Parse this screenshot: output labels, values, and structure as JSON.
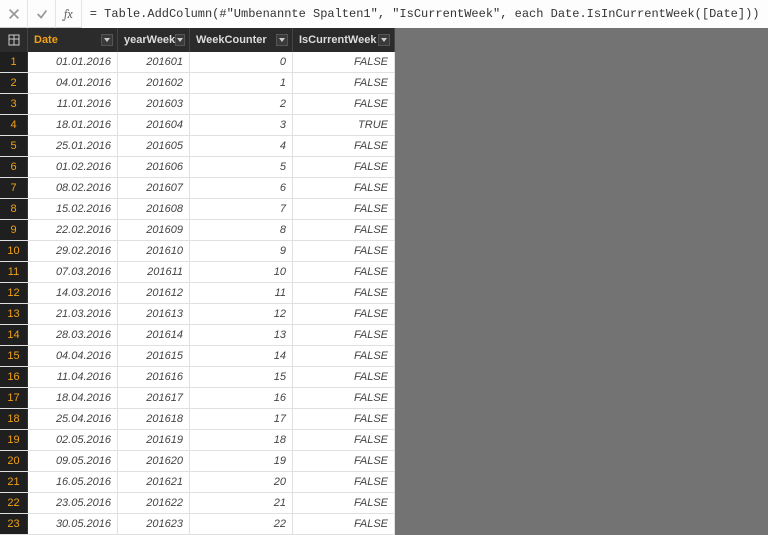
{
  "formula_bar": {
    "fx": "fx",
    "formula": "= Table.AddColumn(#\"Umbenannte Spalten1\", \"IsCurrentWeek\", each Date.IsInCurrentWeek([Date]))"
  },
  "columns": {
    "c0": "Date",
    "c1": "yearWeek",
    "c2": "WeekCounter",
    "c3": "IsCurrentWeek"
  },
  "rows": [
    {
      "n": "1",
      "date": "01.01.2016",
      "yw": "201601",
      "wc": "0",
      "cw": "FALSE"
    },
    {
      "n": "2",
      "date": "04.01.2016",
      "yw": "201602",
      "wc": "1",
      "cw": "FALSE"
    },
    {
      "n": "3",
      "date": "11.01.2016",
      "yw": "201603",
      "wc": "2",
      "cw": "FALSE"
    },
    {
      "n": "4",
      "date": "18.01.2016",
      "yw": "201604",
      "wc": "3",
      "cw": "TRUE"
    },
    {
      "n": "5",
      "date": "25.01.2016",
      "yw": "201605",
      "wc": "4",
      "cw": "FALSE"
    },
    {
      "n": "6",
      "date": "01.02.2016",
      "yw": "201606",
      "wc": "5",
      "cw": "FALSE"
    },
    {
      "n": "7",
      "date": "08.02.2016",
      "yw": "201607",
      "wc": "6",
      "cw": "FALSE"
    },
    {
      "n": "8",
      "date": "15.02.2016",
      "yw": "201608",
      "wc": "7",
      "cw": "FALSE"
    },
    {
      "n": "9",
      "date": "22.02.2016",
      "yw": "201609",
      "wc": "8",
      "cw": "FALSE"
    },
    {
      "n": "10",
      "date": "29.02.2016",
      "yw": "201610",
      "wc": "9",
      "cw": "FALSE"
    },
    {
      "n": "11",
      "date": "07.03.2016",
      "yw": "201611",
      "wc": "10",
      "cw": "FALSE"
    },
    {
      "n": "12",
      "date": "14.03.2016",
      "yw": "201612",
      "wc": "11",
      "cw": "FALSE"
    },
    {
      "n": "13",
      "date": "21.03.2016",
      "yw": "201613",
      "wc": "12",
      "cw": "FALSE"
    },
    {
      "n": "14",
      "date": "28.03.2016",
      "yw": "201614",
      "wc": "13",
      "cw": "FALSE"
    },
    {
      "n": "15",
      "date": "04.04.2016",
      "yw": "201615",
      "wc": "14",
      "cw": "FALSE"
    },
    {
      "n": "16",
      "date": "11.04.2016",
      "yw": "201616",
      "wc": "15",
      "cw": "FALSE"
    },
    {
      "n": "17",
      "date": "18.04.2016",
      "yw": "201617",
      "wc": "16",
      "cw": "FALSE"
    },
    {
      "n": "18",
      "date": "25.04.2016",
      "yw": "201618",
      "wc": "17",
      "cw": "FALSE"
    },
    {
      "n": "19",
      "date": "02.05.2016",
      "yw": "201619",
      "wc": "18",
      "cw": "FALSE"
    },
    {
      "n": "20",
      "date": "09.05.2016",
      "yw": "201620",
      "wc": "19",
      "cw": "FALSE"
    },
    {
      "n": "21",
      "date": "16.05.2016",
      "yw": "201621",
      "wc": "20",
      "cw": "FALSE"
    },
    {
      "n": "22",
      "date": "23.05.2016",
      "yw": "201622",
      "wc": "21",
      "cw": "FALSE"
    },
    {
      "n": "23",
      "date": "30.05.2016",
      "yw": "201623",
      "wc": "22",
      "cw": "FALSE"
    }
  ]
}
